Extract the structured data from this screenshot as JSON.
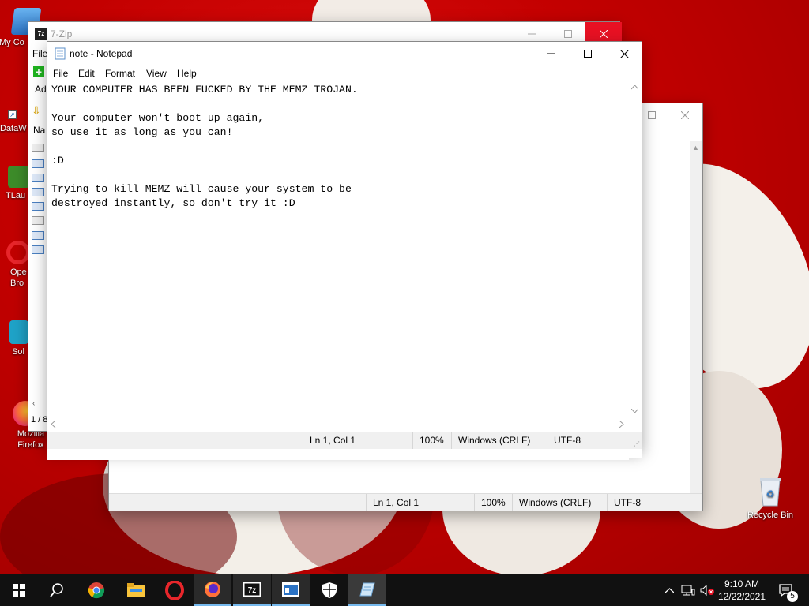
{
  "desktop": {
    "icons": [
      {
        "label": "My Co",
        "name": "my-computer"
      },
      {
        "label": "DataW",
        "name": "dataw"
      },
      {
        "label": "TLau",
        "name": "tlauncher"
      },
      {
        "label": "Ope\nBro",
        "name": "opera-browser"
      },
      {
        "label": "Sol",
        "name": "sol"
      },
      {
        "label": "Mozilla\nFirefox",
        "name": "mozilla-firefox"
      },
      {
        "label": "Recycle Bin",
        "name": "recycle-bin"
      }
    ]
  },
  "zip_window": {
    "title": "7-Zip",
    "menu_fragment": "File",
    "add_fragment": "Ad",
    "name_fragment": "Na",
    "page_fragment": "1 / 8"
  },
  "notepad_back": {
    "status": {
      "position": "Ln 1, Col 1",
      "zoom": "100%",
      "line_ending": "Windows (CRLF)",
      "encoding": "UTF-8"
    }
  },
  "notepad": {
    "title": "note - Notepad",
    "menu": [
      "File",
      "Edit",
      "Format",
      "View",
      "Help"
    ],
    "lines": [
      "YOUR COMPUTER HAS BEEN FUCKED BY THE MEMZ TROJAN.",
      "",
      "Your computer won't boot up again,",
      "so use it as long as you can!",
      "",
      ":D",
      "",
      "Trying to kill MEMZ will cause your system to be",
      "destroyed instantly, so don't try it :D"
    ],
    "status": {
      "position": "Ln 1, Col 1",
      "zoom": "100%",
      "line_ending": "Windows (CRLF)",
      "encoding": "UTF-8"
    }
  },
  "taskbar": {
    "apps": [
      "start-icon",
      "search-icon",
      "chrome-icon",
      "file-explorer-icon",
      "opera-icon",
      "firefox-icon",
      "7zip-icon",
      "window-app-icon",
      "security-icon",
      "notepad-icon"
    ],
    "time": "9:10 AM",
    "date": "12/22/2021",
    "notifications": "5"
  },
  "colors": {
    "accent": "#76b9ed",
    "close_red": "#e81123",
    "wallpaper_red": "#c40000"
  }
}
